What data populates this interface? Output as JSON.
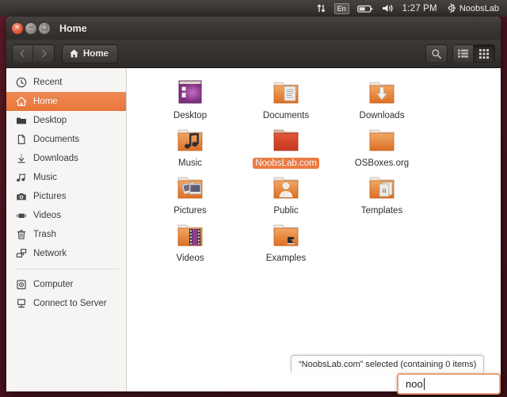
{
  "panel": {
    "network_icon": "network-up-down-icon",
    "keyboard_layout": "En",
    "battery_icon": "battery-icon",
    "volume_icon": "volume-icon",
    "clock": "1:27 PM",
    "session_icon": "gear-icon",
    "username": "NoobsLab"
  },
  "window": {
    "title": "Home",
    "close_label": "×",
    "minimize_label": "−",
    "maximize_label": "□"
  },
  "toolbar": {
    "back_label": "‹",
    "forward_label": "›",
    "breadcrumb": "Home",
    "home_icon": "home-icon",
    "search_icon": "search-icon",
    "list_view_icon": "list-view-icon",
    "grid_view_icon": "grid-view-icon",
    "active_view": "grid"
  },
  "sidebar": {
    "items": [
      {
        "label": "Recent",
        "icon": "clock-icon",
        "selected": false
      },
      {
        "label": "Home",
        "icon": "home-icon",
        "selected": true
      },
      {
        "label": "Desktop",
        "icon": "folder-icon",
        "selected": false
      },
      {
        "label": "Documents",
        "icon": "document-icon",
        "selected": false
      },
      {
        "label": "Downloads",
        "icon": "download-icon",
        "selected": false
      },
      {
        "label": "Music",
        "icon": "music-icon",
        "selected": false
      },
      {
        "label": "Pictures",
        "icon": "camera-icon",
        "selected": false
      },
      {
        "label": "Videos",
        "icon": "video-icon",
        "selected": false
      },
      {
        "label": "Trash",
        "icon": "trash-icon",
        "selected": false
      },
      {
        "label": "Network",
        "icon": "network-icon",
        "selected": false
      }
    ],
    "items2": [
      {
        "label": "Computer",
        "icon": "computer-icon",
        "selected": false
      },
      {
        "label": "Connect to Server",
        "icon": "server-icon",
        "selected": false
      }
    ]
  },
  "files": [
    {
      "label": "Desktop",
      "icon": "desktop-window-icon",
      "selected": false
    },
    {
      "label": "Documents",
      "icon": "folder-documents-icon",
      "selected": false
    },
    {
      "label": "Downloads",
      "icon": "folder-downloads-icon",
      "selected": false
    },
    {
      "label": "Music",
      "icon": "folder-music-icon",
      "selected": false
    },
    {
      "label": "NoobsLab.com",
      "icon": "folder-icon",
      "selected": true
    },
    {
      "label": "OSBoxes.org",
      "icon": "folder-icon",
      "selected": false
    },
    {
      "label": "Pictures",
      "icon": "folder-pictures-icon",
      "selected": false
    },
    {
      "label": "Public",
      "icon": "folder-public-icon",
      "selected": false
    },
    {
      "label": "Templates",
      "icon": "folder-templates-icon",
      "selected": false
    },
    {
      "label": "Videos",
      "icon": "folder-videos-icon",
      "selected": false
    },
    {
      "label": "Examples",
      "icon": "folder-symlink-icon",
      "selected": false
    }
  ],
  "status": {
    "text": "“NoobsLab.com” selected  (containing 0 items)"
  },
  "search": {
    "value": "noo"
  },
  "colors": {
    "accent_orange": "#e8763a",
    "selection_orange": "#ee7b42",
    "folder_orange": "#e8833c",
    "selected_folder_red": "#d5432a",
    "desktop_purple": "#8e3d8e",
    "panel_dark": "#3b3735",
    "desktop_background": "#4a1520"
  }
}
